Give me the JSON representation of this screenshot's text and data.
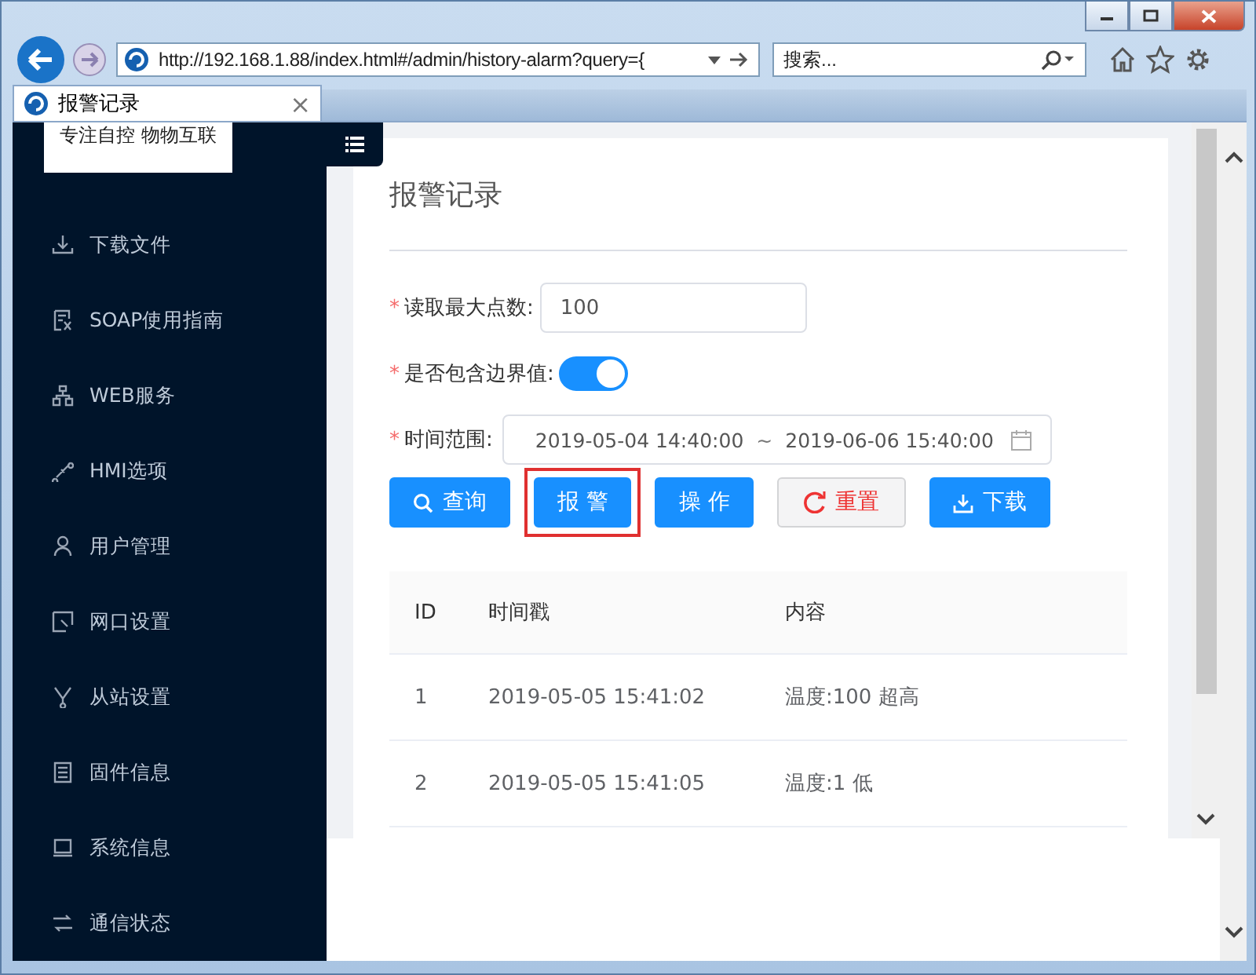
{
  "browser": {
    "address": "http://192.168.1.88/index.html#/admin/history-alarm?query={",
    "search_placeholder": "搜索...",
    "tab": {
      "title": "报警记录",
      "close": "×"
    }
  },
  "sidebar": {
    "brand": "专注自控 物物互联",
    "items": [
      {
        "label": "下载文件"
      },
      {
        "label": "SOAP使用指南"
      },
      {
        "label": "WEB服务"
      },
      {
        "label": "HMI选项"
      },
      {
        "label": "用户管理"
      },
      {
        "label": "网口设置"
      },
      {
        "label": "从站设置"
      },
      {
        "label": "固件信息"
      },
      {
        "label": "系统信息"
      },
      {
        "label": "通信状态"
      }
    ]
  },
  "page": {
    "title": "报警记录",
    "form": [
      {
        "kind": "input",
        "required_mark": "*",
        "label": "读取最大点数:",
        "value": "100"
      },
      {
        "kind": "switch",
        "required_mark": "*",
        "label": "是否包含边界值:",
        "on": true
      },
      {
        "kind": "daterange",
        "required_mark": "*",
        "label": "时间范围:",
        "start": "2019-05-04 14:40:00",
        "separator": "~",
        "end": "2019-06-06 15:40:00"
      }
    ],
    "buttons": [
      {
        "kind": "search",
        "label": "查询",
        "highlighted": false
      },
      {
        "kind": "primary",
        "label": "报 警",
        "highlighted": true
      },
      {
        "kind": "primary",
        "label": "操 作",
        "highlighted": false
      },
      {
        "kind": "reset",
        "label": "重置",
        "highlighted": false
      },
      {
        "kind": "download",
        "label": "下载",
        "highlighted": false
      }
    ],
    "table": {
      "columns": [
        "ID",
        "时间戳",
        "内容"
      ],
      "rows": [
        [
          "1",
          "2019-05-05 15:41:02",
          "温度:100 超高"
        ],
        [
          "2",
          "2019-05-05 15:41:05",
          "温度:1 低"
        ]
      ]
    }
  }
}
